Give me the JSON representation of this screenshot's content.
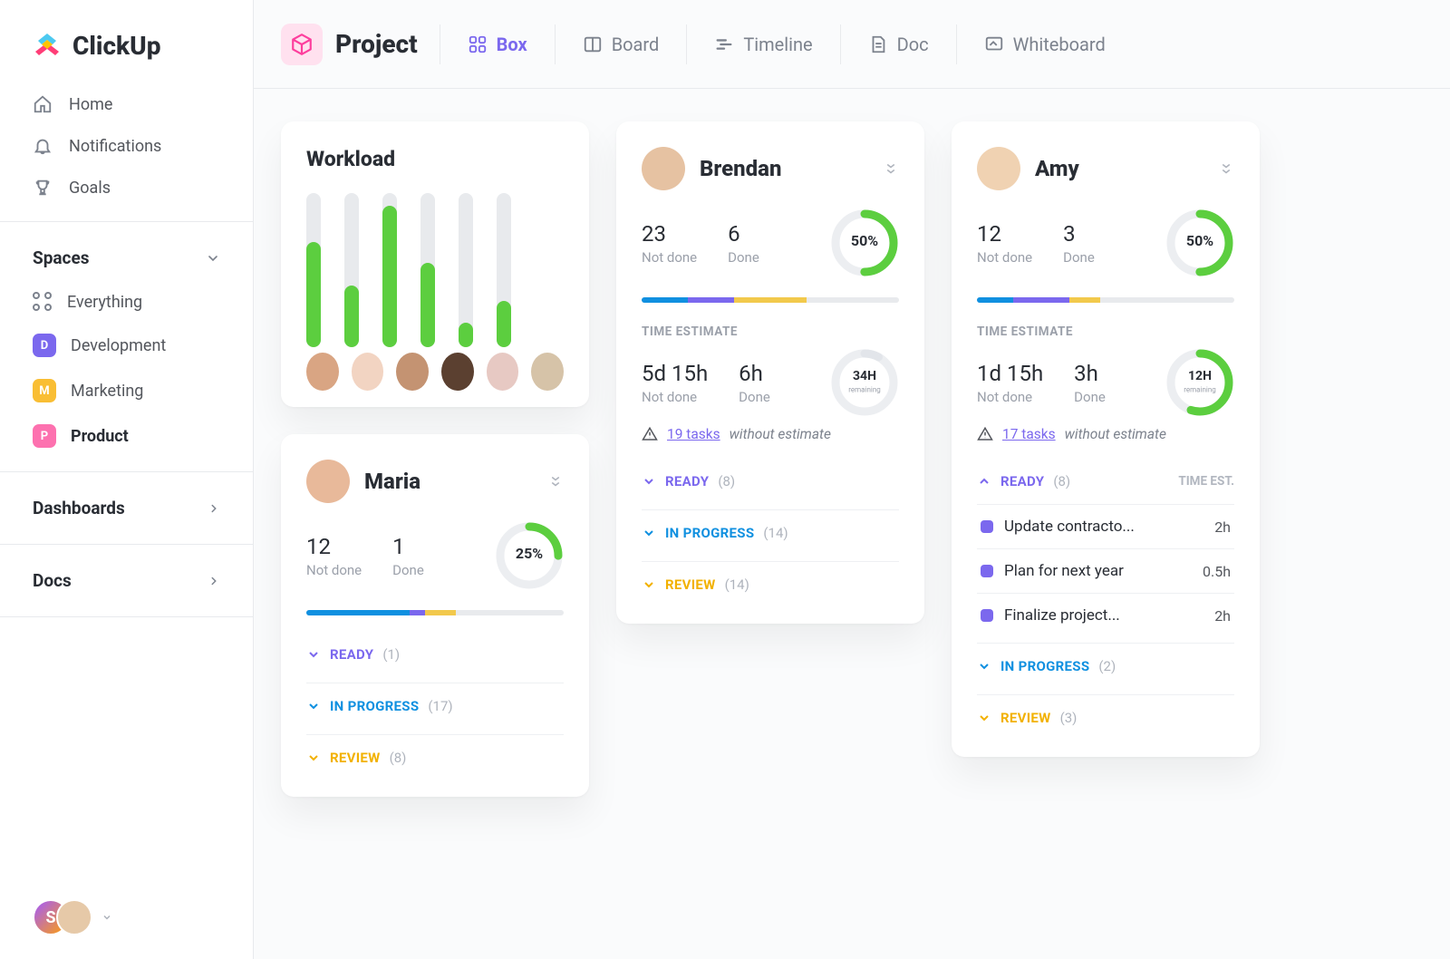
{
  "brand": {
    "name": "ClickUp"
  },
  "nav": [
    {
      "icon": "home",
      "label": "Home"
    },
    {
      "icon": "bell",
      "label": "Notifications"
    },
    {
      "icon": "trophy",
      "label": "Goals"
    }
  ],
  "spaces_header": "Spaces",
  "spaces": [
    {
      "type": "everything",
      "label": "Everything"
    },
    {
      "type": "badge",
      "initial": "D",
      "color": "#7b68ee",
      "label": "Development"
    },
    {
      "type": "badge",
      "initial": "M",
      "color": "#f9be34",
      "label": "Marketing"
    },
    {
      "type": "badge",
      "initial": "P",
      "color": "#fd71af",
      "label": "Product",
      "active": true
    }
  ],
  "sidebar_sections": [
    {
      "label": "Dashboards"
    },
    {
      "label": "Docs"
    }
  ],
  "footer_user_initial": "S",
  "topbar": {
    "project_label": "Project",
    "views": [
      {
        "icon": "box",
        "label": "Box",
        "active": true
      },
      {
        "icon": "board",
        "label": "Board"
      },
      {
        "icon": "timeline",
        "label": "Timeline"
      },
      {
        "icon": "doc",
        "label": "Doc"
      },
      {
        "icon": "whiteboard",
        "label": "Whiteboard"
      }
    ]
  },
  "workload": {
    "title": "Workload",
    "bars": [
      68,
      40,
      92,
      55,
      16,
      30
    ],
    "avatar_colors": [
      "#d9a583",
      "#f2d4c2",
      "#c49372",
      "#5b4030",
      "#e7c9c3",
      "#d6c3a8"
    ]
  },
  "people": [
    {
      "name": "Maria",
      "avatar_color": "#e8b99a",
      "not_done": "12",
      "done": "1",
      "ring_pct": 25,
      "ring_label": "25%",
      "segments": [
        {
          "color": "#1090e0",
          "pct": 40
        },
        {
          "color": "#7b68ee",
          "pct": 6
        },
        {
          "color": "#f2c94c",
          "pct": 12
        }
      ],
      "statuses": [
        {
          "key": "ready",
          "label": "READY",
          "count": 1,
          "open": false
        },
        {
          "key": "inprog",
          "label": "IN PROGRESS",
          "count": 17,
          "open": false
        },
        {
          "key": "review",
          "label": "REVIEW",
          "count": 8,
          "open": false
        }
      ]
    },
    {
      "name": "Brendan",
      "avatar_color": "#e6c2a2",
      "not_done": "23",
      "done": "6",
      "ring_pct": 50,
      "ring_label": "50%",
      "segments": [
        {
          "color": "#1090e0",
          "pct": 18
        },
        {
          "color": "#7b68ee",
          "pct": 18
        },
        {
          "color": "#f2c94c",
          "pct": 28
        }
      ],
      "time_estimate_label": "TIME ESTIMATE",
      "te_not_done": "5d 15h",
      "te_done": "6h",
      "te_ring_pct": 8,
      "te_ring_label": "34H",
      "te_ring_sub": "remaining",
      "warn_link": "19 tasks",
      "warn_rest": "without estimate",
      "statuses": [
        {
          "key": "ready",
          "label": "READY",
          "count": 8,
          "open": false
        },
        {
          "key": "inprog",
          "label": "IN PROGRESS",
          "count": 14,
          "open": false
        },
        {
          "key": "review",
          "label": "REVIEW",
          "count": 14,
          "open": false
        }
      ]
    },
    {
      "name": "Amy",
      "avatar_color": "#f0d2b2",
      "not_done": "12",
      "done": "3",
      "ring_pct": 50,
      "ring_label": "50%",
      "segments": [
        {
          "color": "#1090e0",
          "pct": 14
        },
        {
          "color": "#7b68ee",
          "pct": 22
        },
        {
          "color": "#f2c94c",
          "pct": 12
        }
      ],
      "time_estimate_label": "TIME ESTIMATE",
      "te_not_done": "1d 15h",
      "te_done": "3h",
      "te_ring_pct": 55,
      "te_ring_label": "12H",
      "te_ring_sub": "remaining",
      "warn_link": "17 tasks",
      "warn_rest": "without estimate",
      "time_est_header": "TIME EST.",
      "statuses": [
        {
          "key": "ready",
          "label": "READY",
          "count": 8,
          "open": true,
          "tasks": [
            {
              "title": "Update contracto...",
              "time": "2h"
            },
            {
              "title": "Plan for next year",
              "time": "0.5h"
            },
            {
              "title": "Finalize project...",
              "time": "2h"
            }
          ]
        },
        {
          "key": "inprog",
          "label": "IN PROGRESS",
          "count": 2,
          "open": false
        },
        {
          "key": "review",
          "label": "REVIEW",
          "count": 3,
          "open": false
        }
      ]
    }
  ],
  "labels": {
    "not_done": "Not done",
    "done": "Done"
  }
}
